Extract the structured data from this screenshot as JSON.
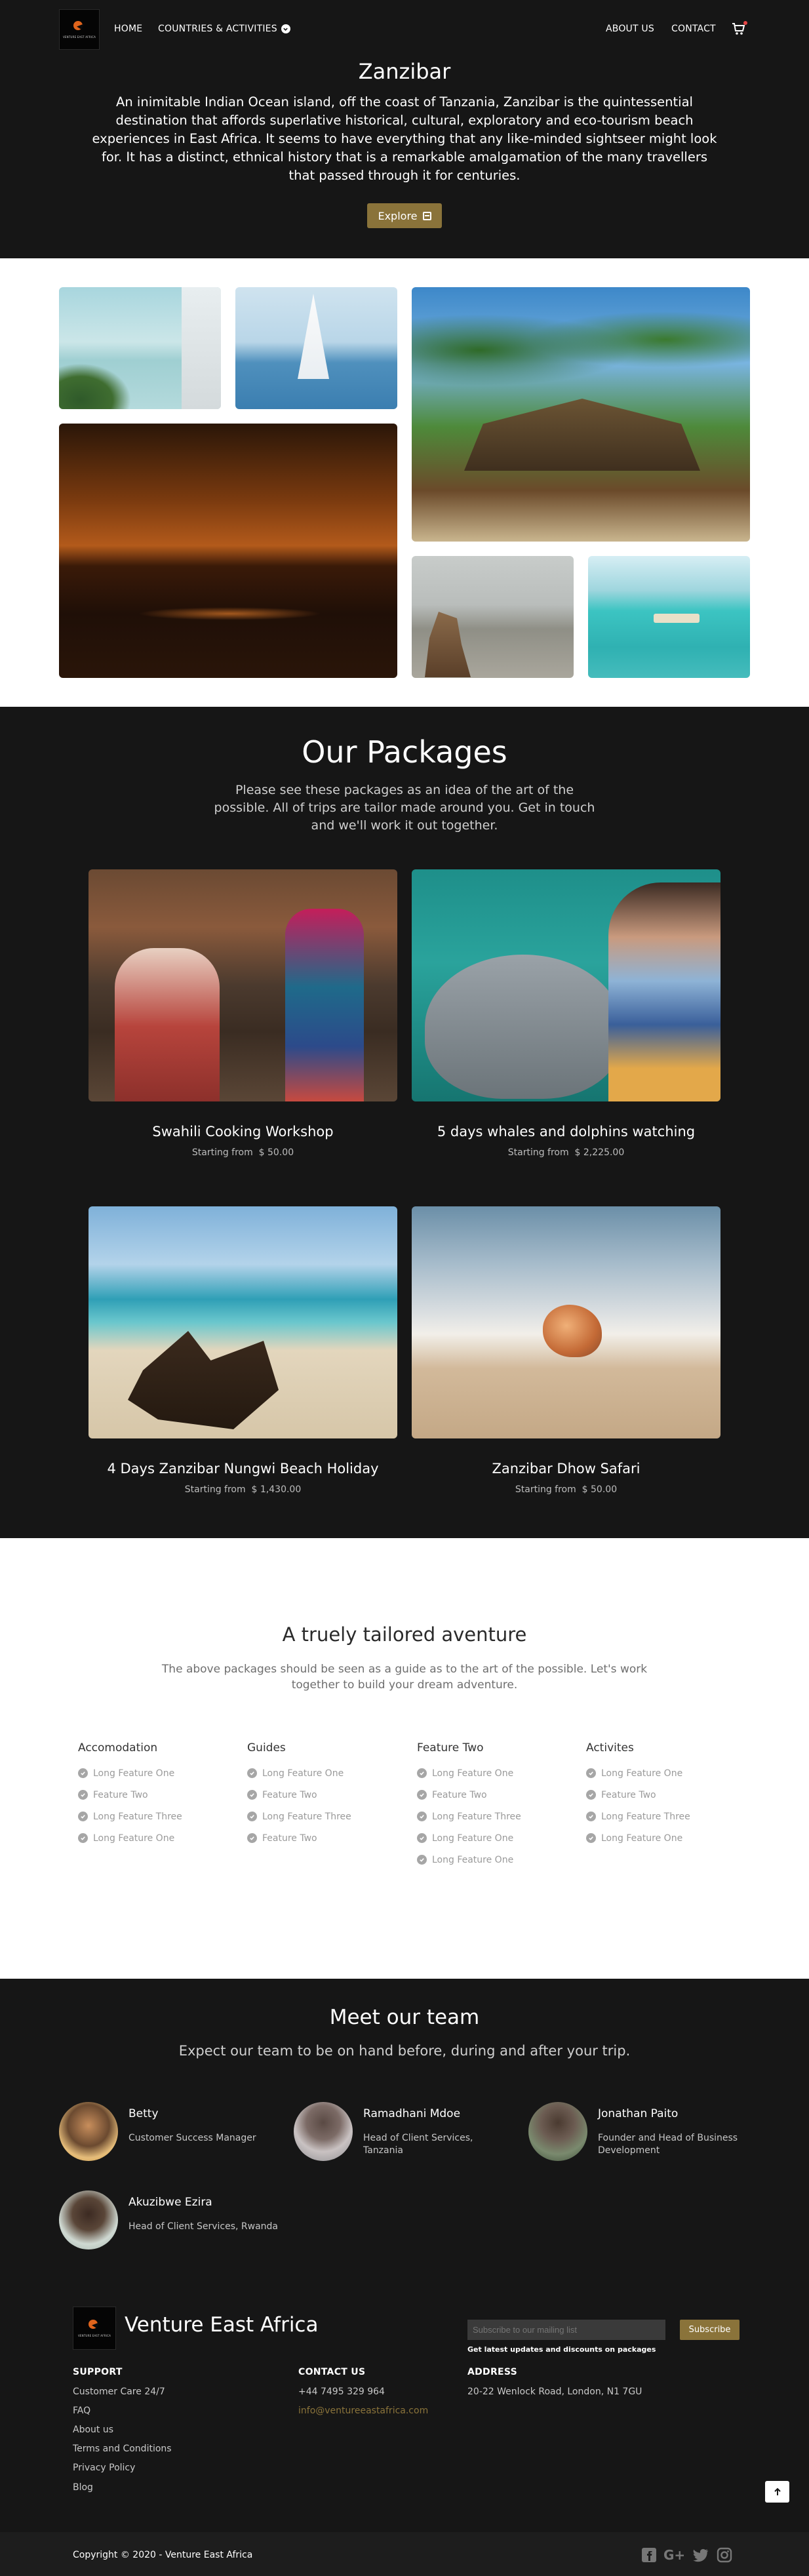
{
  "nav": {
    "logo_text": "VENTURE EAST AFRICA",
    "home": "HOME",
    "countries": "COUNTRIES & ACTIVITIES",
    "about": "ABOUT US",
    "contact": "CONTACT"
  },
  "hero": {
    "title": "Zanzibar",
    "description": "An inimitable Indian Ocean island, off the coast of Tanzania, Zanzibar is the quintessential destination that affords superlative historical, cultural, exploratory and eco-tourism beach experiences in East Africa. It seems to have everything that any like-minded sightseer might look for. It has a distinct, ethnical history that is a remarkable amalgamation of the many travellers that passed through it for centuries.",
    "button": "Explore"
  },
  "packages": {
    "title": "Our Packages",
    "description": "Please see these packages as an idea of the art of the possible. All of trips are tailor made around you. Get in touch and we'll work it out together.",
    "items": [
      {
        "name": "Swahili Cooking Workshop",
        "price_prefix": "Starting from",
        "price": "$ 50.00"
      },
      {
        "name": "5 days whales and dolphins watching",
        "price_prefix": "Starting from",
        "price": "$ 2,225.00"
      },
      {
        "name": "4 Days Zanzibar Nungwi Beach Holiday",
        "price_prefix": "Starting from",
        "price": "$ 1,430.00"
      },
      {
        "name": "Zanzibar Dhow Safari",
        "price_prefix": "Starting from",
        "price": "$ 50.00"
      }
    ]
  },
  "tailored": {
    "title": "A truely tailored aventure",
    "description": "The above packages should be seen as a guide as to the art of the possible. Let's work together to build your dream adventure.",
    "columns": [
      {
        "heading": "Accomodation",
        "features": [
          "Long Feature One",
          "Feature Two",
          "Long Feature Three",
          "Long Feature One"
        ]
      },
      {
        "heading": "Guides",
        "features": [
          "Long Feature One",
          "Feature Two",
          "Long Feature Three",
          "Feature Two"
        ]
      },
      {
        "heading": "Feature Two",
        "features": [
          "Long Feature One",
          "Feature Two",
          "Long Feature Three",
          "Long Feature One",
          "Long Feature One"
        ]
      },
      {
        "heading": "Activites",
        "features": [
          "Long Feature One",
          "Feature Two",
          "Long Feature Three",
          "Long Feature One"
        ]
      }
    ]
  },
  "team": {
    "title": "Meet our team",
    "description": "Expect our team to be on hand before, during and after your trip.",
    "members": [
      {
        "name": "Betty",
        "role": "Customer Success Manager"
      },
      {
        "name": "Ramadhani Mdoe",
        "role": "Head of Client Services, Tanzania"
      },
      {
        "name": "Jonathan Paito",
        "role": "Founder and Head of Business Development"
      },
      {
        "name": "Akuzibwe Ezira",
        "role": "Head of Client Services, Rwanda"
      }
    ]
  },
  "footer": {
    "brand": "Venture East Africa",
    "subscribe_placeholder": "Subscribe to our mailing list",
    "subscribe_button": "Subscribe",
    "subscribe_note": "Get latest updates and discounts on packages",
    "support": {
      "heading": "SUPPORT",
      "links": [
        "Customer Care 24/7",
        "FAQ",
        "About us",
        "Terms and Conditions",
        "Privacy Policy",
        "Blog"
      ]
    },
    "contact": {
      "heading": "CONTACT US",
      "phone": "+44 7495 329 964",
      "email": "info@ventureeastafrica.com"
    },
    "address": {
      "heading": "ADDRESS",
      "line": "20-22 Wenlock Road, London, N1 7GU"
    },
    "copyright": "Copyright © 2020 - Venture East Africa"
  },
  "icons": {
    "accent_color": "#8a733a",
    "cart": "cart-icon",
    "social": [
      "facebook-icon",
      "google-plus-icon",
      "twitter-icon",
      "instagram-icon"
    ]
  }
}
